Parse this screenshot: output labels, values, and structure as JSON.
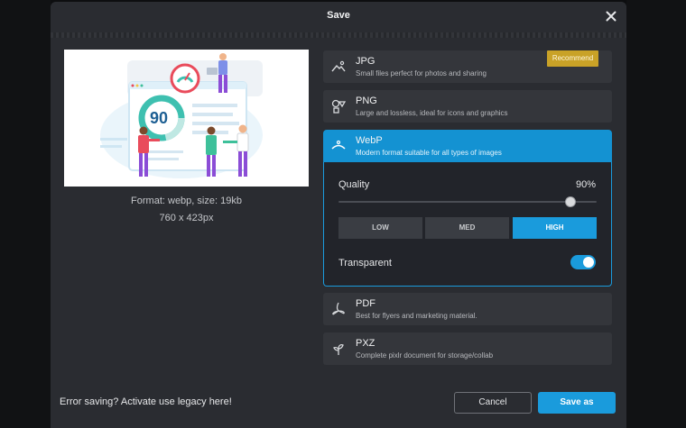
{
  "dialog": {
    "title": "Save"
  },
  "preview": {
    "illustration_text": "90",
    "format_info": "Format: webp, size: 19kb",
    "dimensions": "760 x 423px"
  },
  "formats": [
    {
      "name": "JPG",
      "description": "Small files perfect for photos and sharing",
      "badge": "Recommend",
      "icon": "image-landscape-icon"
    },
    {
      "name": "PNG",
      "description": "Large and lossless, ideal for icons and graphics",
      "icon": "shapes-icon"
    },
    {
      "name": "WebP",
      "description": "Modern format suitable for all types of images",
      "icon": "webp-arc-icon",
      "selected": true
    },
    {
      "name": "PDF",
      "description": "Best for flyers and marketing material.",
      "icon": "pdf-icon"
    },
    {
      "name": "PXZ",
      "description": "Complete pixlr document for storage/collab",
      "icon": "pixlr-sprout-icon"
    }
  ],
  "options": {
    "quality_label": "Quality",
    "quality_value": "90%",
    "quality_fraction": 0.9,
    "presets": [
      "LOW",
      "MED",
      "HIGH"
    ],
    "active_preset": "HIGH",
    "transparent_label": "Transparent",
    "transparent_on": true
  },
  "footer": {
    "error_text": "Error saving? Activate use legacy here!",
    "cancel_label": "Cancel",
    "save_label": "Save as"
  },
  "colors": {
    "accent": "#1a9bdc",
    "badge": "#c9a227",
    "surface": "#2a2c31",
    "card": "#34363b"
  }
}
